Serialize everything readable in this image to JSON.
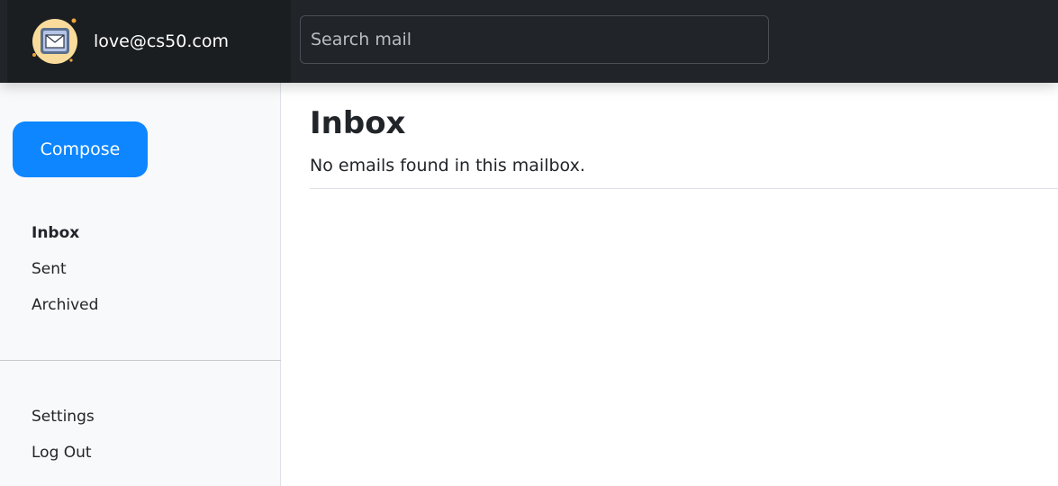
{
  "header": {
    "account_email": "love@cs50.com",
    "logo_icon": "envelope-icon",
    "search": {
      "placeholder": "Search mail",
      "value": ""
    }
  },
  "sidebar": {
    "compose_label": "Compose",
    "mailboxes": [
      {
        "label": "Inbox",
        "active": true
      },
      {
        "label": "Sent",
        "active": false
      },
      {
        "label": "Archived",
        "active": false
      }
    ],
    "account_links": [
      {
        "label": "Settings"
      },
      {
        "label": "Log Out"
      }
    ]
  },
  "main": {
    "title": "Inbox",
    "empty_message": "No emails found in this mailbox."
  },
  "colors": {
    "topbar": "#212529",
    "brand_panel": "#1b1e21",
    "compose_button": "#0d86ff",
    "sidebar_bg": "#f8f9fa"
  }
}
